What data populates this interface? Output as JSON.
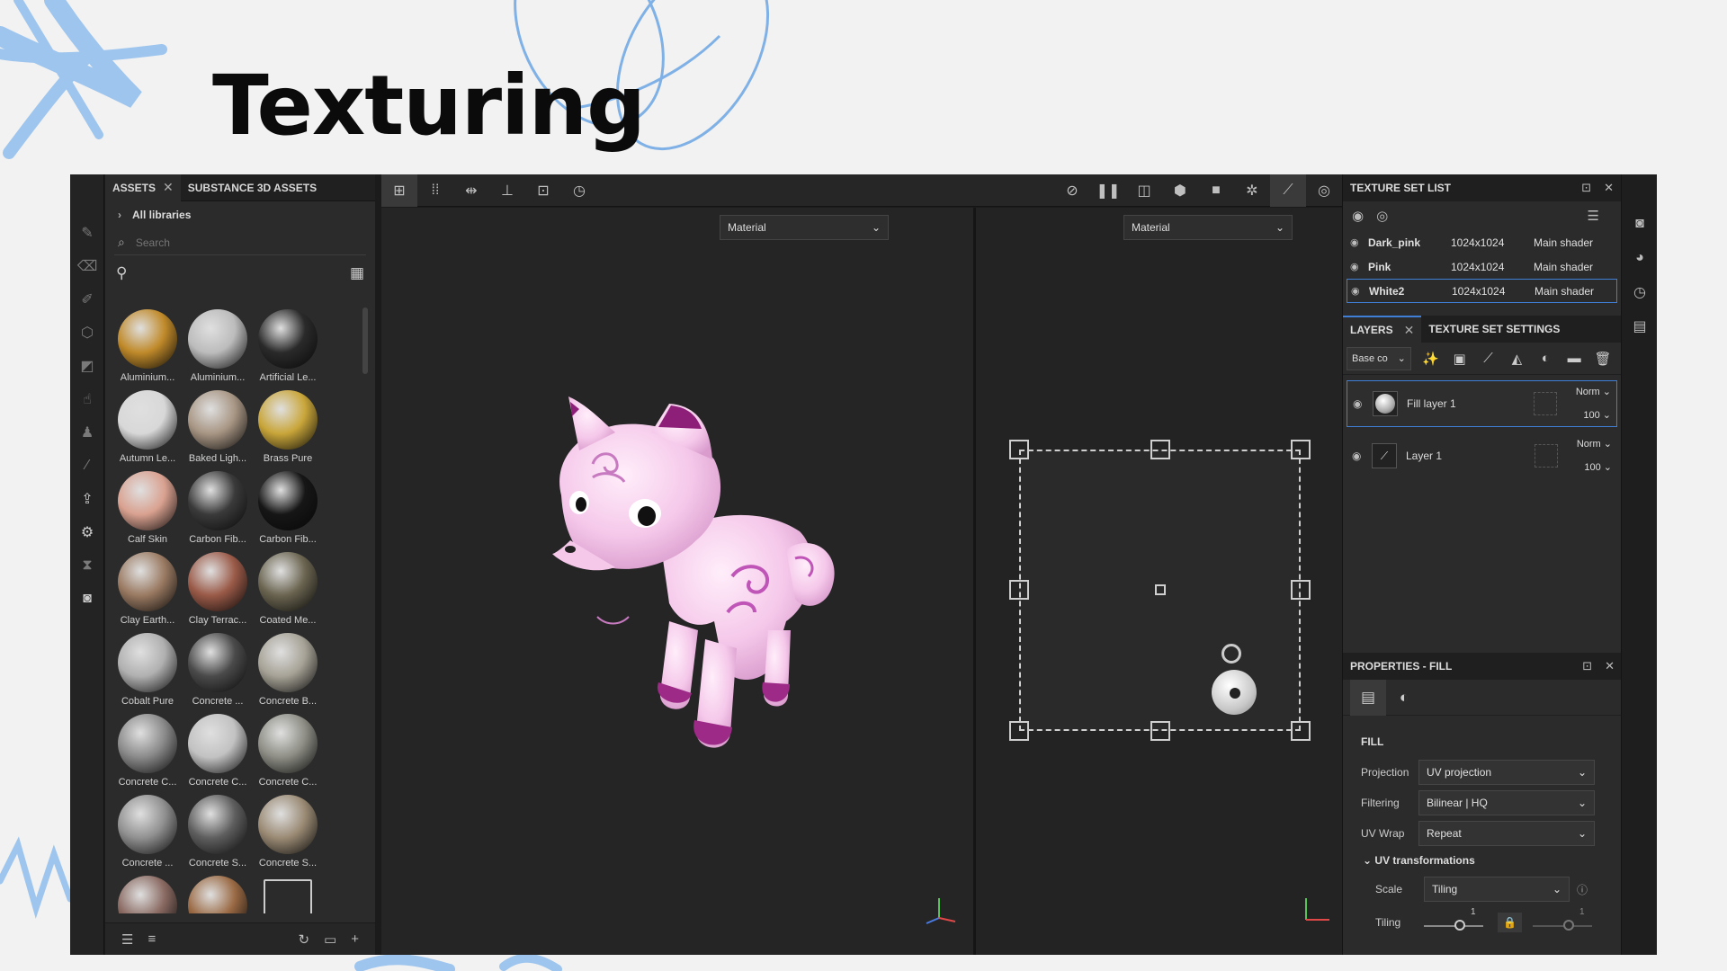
{
  "slide": {
    "title": "Texturing"
  },
  "colors": {
    "accent": "#3f7fd8",
    "brush_stroke": "#9ec5ee"
  },
  "assets_panel": {
    "tabs": [
      {
        "label": "ASSETS"
      },
      {
        "label": "SUBSTANCE 3D ASSETS"
      }
    ],
    "library": "All libraries",
    "search_placeholder": "Search",
    "materials": [
      {
        "label": "Aluminium...",
        "color": "#c08a2a"
      },
      {
        "label": "Aluminium...",
        "color": "#bcbcbc"
      },
      {
        "label": "Artificial Le...",
        "color": "#2a2a2a"
      },
      {
        "label": "Autumn Le...",
        "color": "#d8d8d8"
      },
      {
        "label": "Baked Ligh...",
        "color": "#a89684"
      },
      {
        "label": "Brass Pure",
        "color": "#c9a63a"
      },
      {
        "label": "Calf Skin",
        "color": "#d9a190"
      },
      {
        "label": "Carbon Fib...",
        "color": "#3a3a3a"
      },
      {
        "label": "Carbon Fib...",
        "color": "#161616"
      },
      {
        "label": "Clay Earth...",
        "color": "#9a7a62"
      },
      {
        "label": "Clay Terrac...",
        "color": "#9a5a48"
      },
      {
        "label": "Coated Me...",
        "color": "#6a6450"
      },
      {
        "label": "Cobalt Pure",
        "color": "#b0b0b0"
      },
      {
        "label": "Concrete ...",
        "color": "#4a4a4a"
      },
      {
        "label": "Concrete B...",
        "color": "#a6a296"
      },
      {
        "label": "Concrete C...",
        "color": "#8a8a8a"
      },
      {
        "label": "Concrete C...",
        "color": "#c2c2c2"
      },
      {
        "label": "Concrete C...",
        "color": "#8e8e86"
      },
      {
        "label": "Concrete ...",
        "color": "#909090"
      },
      {
        "label": "Concrete S...",
        "color": "#5e5e5e"
      },
      {
        "label": "Concrete S...",
        "color": "#9a8a74"
      },
      {
        "label": "",
        "color": "#8a6a62"
      },
      {
        "label": "",
        "color": "#9a6a44"
      },
      {
        "label": "",
        "color": "#2b2b2b"
      }
    ]
  },
  "viewport": {
    "left_mode": "Material",
    "right_mode": "Material"
  },
  "texture_set_list": {
    "title": "TEXTURE SET LIST",
    "rows": [
      {
        "name": "Dark_pink",
        "resolution": "1024x1024",
        "shader": "Main shader"
      },
      {
        "name": "Pink",
        "resolution": "1024x1024",
        "shader": "Main shader"
      },
      {
        "name": "White2",
        "resolution": "1024x1024",
        "shader": "Main shader"
      }
    ]
  },
  "layers_panel": {
    "tabs": [
      {
        "label": "LAYERS"
      },
      {
        "label": "TEXTURE SET SETTINGS"
      }
    ],
    "channel": "Base co",
    "layers": [
      {
        "name": "Fill layer 1",
        "blend": "Norm",
        "opacity": "100"
      },
      {
        "name": "Layer 1",
        "blend": "Norm",
        "opacity": "100"
      }
    ]
  },
  "properties": {
    "title": "PROPERTIES - FILL",
    "section": "FILL",
    "rows": [
      {
        "key": "Projection",
        "value": "UV projection"
      },
      {
        "key": "Filtering",
        "value": "Bilinear | HQ"
      },
      {
        "key": "UV Wrap",
        "value": "Repeat"
      }
    ],
    "uv_section": "UV transformations",
    "scale_key": "Scale",
    "scale_value": "Tiling",
    "tiling_key": "Tiling",
    "tiling_values": [
      "1",
      "1"
    ]
  }
}
